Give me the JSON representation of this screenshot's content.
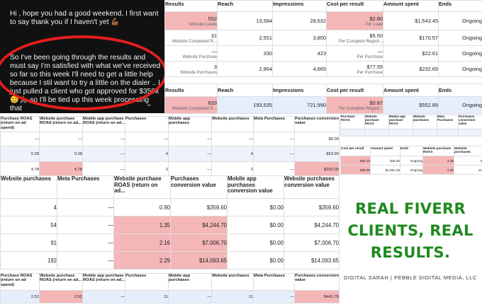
{
  "chat": {
    "line1": "Hi , hope you had a good weekend, I first want to say thank you if I haven't yet 💪🏾",
    "line2": "So I've been going through the results and must say I'm satisfied with what we've received so far so this week I'll need to get a little help because I stil want to try a little on the dialer .. I just pulled a client who got approved for $350k 😊🙏🏾 so I'll be tied up this week processing that"
  },
  "table_top": {
    "headers": [
      "Results",
      "Reach",
      "Impressions",
      "Cost per result",
      "Amount spent",
      "Ends"
    ],
    "rows": [
      {
        "results": "552",
        "results_sub": "Website Leads",
        "reach": "13,584",
        "impressions": "28,632",
        "cpr": "$2.80",
        "cpr_sub": "Per Lead",
        "spent": "$1,543.45",
        "ends": "Ongoing"
      },
      {
        "results": "31",
        "results_sub": "Website Completed R...",
        "reach": "2,551",
        "impressions": "3,850",
        "cpr": "$5.50",
        "cpr_sub": "Per Complete Registr...",
        "spent": "$170.57",
        "ends": "Ongoing"
      },
      {
        "results": "—",
        "results_sub": "Website Purchase",
        "reach": "330",
        "impressions": "423",
        "cpr": "—",
        "cpr_sub": "Per Purchase",
        "spent": "$22.61",
        "ends": "Ongoing"
      },
      {
        "results": "3",
        "results_sub": "Website Purchases",
        "reach": "2,864",
        "impressions": "4,665",
        "cpr": "$77.55",
        "cpr_sub": "Per Purchase",
        "spent": "$232.65",
        "ends": "Ongoing"
      }
    ]
  },
  "table_mid": {
    "headers": [
      "Results",
      "Reach",
      "Impressions",
      "Cost per result",
      "Amount spent",
      "Ends"
    ],
    "row": {
      "results": "633",
      "results_sub": "Website Completed R...",
      "reach": "193,535",
      "impressions": "721,990",
      "cpr": "$0.87",
      "cpr_sub": "Per Complete Registr...",
      "spent": "$552.89",
      "ends": "Ongoing"
    }
  },
  "table_small": {
    "headers": [
      "Purchase ROAS (return on ad spend)",
      "Website purchase ROAS (return on ad...",
      "Mobile app purchase ROAS (return on ad...",
      "Purchases",
      "Mobile app purchases",
      "Website purchases",
      "Meta Purchases",
      "Purchases conversion value"
    ],
    "rows": [
      [
        "—",
        "—",
        "—",
        "—",
        "—",
        "—",
        "—",
        "$0.00"
      ],
      [
        "0.38",
        "0.38",
        "—",
        "4",
        "—",
        "4",
        "—",
        "$63.90"
      ],
      [
        "4.78",
        "4.78",
        "—",
        "2",
        "—",
        "2",
        "—",
        "$202.00"
      ]
    ]
  },
  "table_tiny": {
    "headers": [
      "Purchase ROAS",
      "Website purchase ROAS",
      "Mobile app purchase ROAS",
      "Website purchases",
      "Meta Purchases",
      "Purchases conversion value"
    ],
    "rows": [
      [
        "",
        "",
        "",
        "",
        "",
        ""
      ]
    ]
  },
  "table_tiny2": {
    "headers": [
      "Cost per result",
      "Amount spent",
      "Ends",
      "Website purchase ROAS",
      "Website purchases"
    ],
    "rows": [
      [
        "$26.13",
        "$45.30",
        "Ongoing",
        "3.36",
        "3"
      ],
      [
        "$35.08",
        "$1,061.26",
        "Ongoing",
        "2.38",
        "21"
      ]
    ]
  },
  "table_big": {
    "headers": [
      "Website purchases",
      "Meta Purchases",
      "Website purchase ROAS (return on ad...",
      "Purchases conversion value",
      "Mobile app purchases conversion value",
      "Website purchases conversion value"
    ],
    "rows": [
      [
        "4",
        "—",
        "0.90",
        "$359.60",
        "$0.00",
        "$359.60"
      ],
      [
        "54",
        "—",
        "1.35",
        "$4,244.70",
        "$0.00",
        "$4,244.70"
      ],
      [
        "91",
        "—",
        "2.16",
        "$7,006.70",
        "$0.00",
        "$7,006.70"
      ],
      [
        "192",
        "—",
        "2.29",
        "$14,093.65",
        "$0.00",
        "$14,093.65"
      ]
    ]
  },
  "table_bottom": {
    "headers": [
      "Purchase ROAS (return on ad spend)",
      "Website purchase ROAS (return on ad...",
      "Mobile app purchase ROAS (return on ad...",
      "Purchases",
      "Mobile app purchases",
      "Website purchases",
      "Meta Purchases",
      "Purchases conversion value"
    ],
    "row": [
      "2.52",
      "2.52",
      "—",
      "11",
      "—",
      "11",
      "—",
      "$441.78"
    ]
  },
  "headline": {
    "line1": "REAL FIVERR",
    "line2": "CLIENTS, REAL",
    "line3": "RESULTS."
  },
  "credit": "DIGITAL SARAH | PEBBLE DIGITAL MEDIA, LLC",
  "colors": {
    "highlight": "#f4b6b6",
    "headline": "#1f8a1f",
    "oval": "#e41e1e",
    "chat_bg": "#111111"
  }
}
